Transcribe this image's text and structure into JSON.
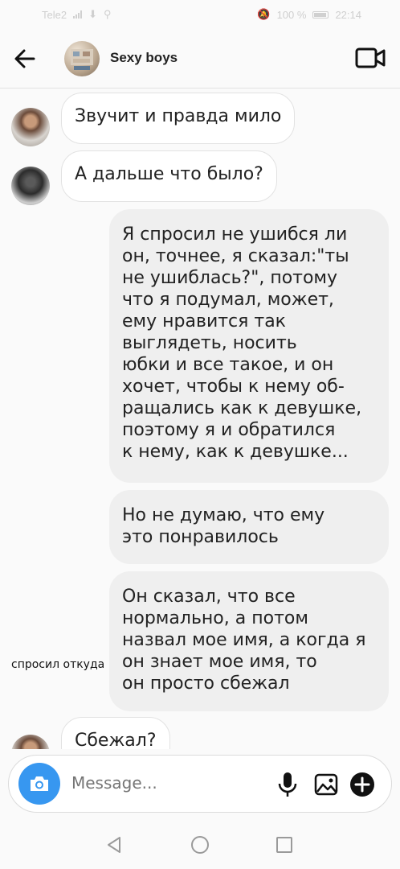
{
  "status_bar": {
    "carrier": "Tele2",
    "battery": "100 %",
    "time": "22:14"
  },
  "header": {
    "title": "Sexy boys"
  },
  "messages": [
    {
      "type": "incoming",
      "text": "Звучит и правда мило"
    },
    {
      "type": "incoming",
      "text": "А дальше что было?"
    },
    {
      "type": "outgoing",
      "lines": [
        "Я спросил не ушибся ли",
        "он, точнее, я сказал:\"ты",
        "не ушиблась?\", потому",
        "что я подумал, может,",
        "ему нравится так",
        "выглядеть, носить",
        "юбки и все такое, и он",
        "хочет, чтобы к нему об-",
        "ращались как к девушке,",
        "поэтому я и обратился",
        "к нему, как к девушке..."
      ]
    },
    {
      "type": "outgoing",
      "lines": [
        "Но не думаю, что ему",
        "это понравилось"
      ]
    },
    {
      "type": "outgoing",
      "lines": [
        "Он сказал, что все",
        "нормально, а потом",
        "назвал мое имя, а когда я",
        "он знает мое имя, то",
        "он просто сбежал"
      ]
    },
    {
      "type": "incoming",
      "text": "Сбежал?"
    }
  ],
  "overlay_text": "спросил откуда",
  "composer": {
    "placeholder": "Message..."
  },
  "colors": {
    "accent": "#3797f0",
    "incoming_bubble": "#ffffff",
    "outgoing_bubble": "#efefef"
  },
  "icons": {
    "back": "arrow-left-icon",
    "video": "video-camera-icon",
    "camera": "camera-icon",
    "mic": "microphone-icon",
    "gallery": "image-icon",
    "plus": "plus-circle-icon"
  }
}
